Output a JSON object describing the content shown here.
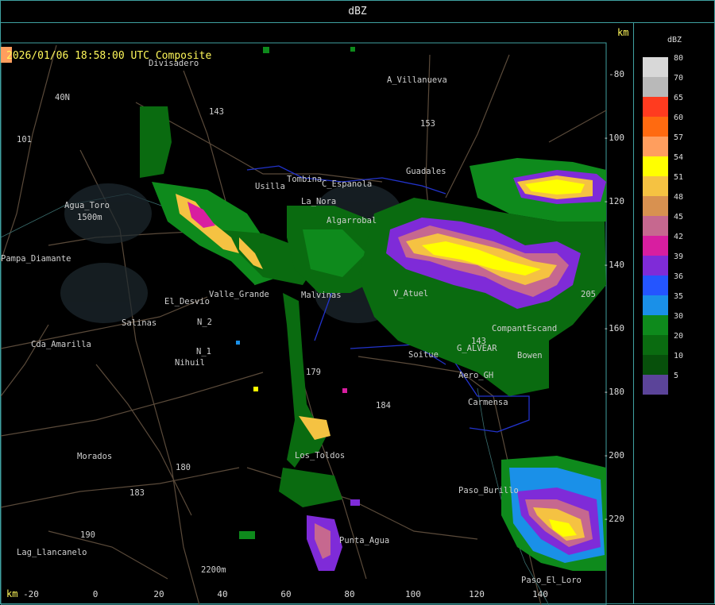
{
  "header": {
    "title": "dBZ"
  },
  "map": {
    "timestamp": "2026/01/06 18:58:00 UTC Composite",
    "km_top": "km",
    "km_bottom": "km",
    "x_axis_ticks": [
      "-20",
      "0",
      "20",
      "40",
      "60",
      "80",
      "100",
      "120",
      "140"
    ],
    "y_axis_ticks": [
      "-80",
      "-100",
      "-120",
      "-140",
      "-160",
      "-180",
      "-200",
      "-220"
    ],
    "places": [
      "Divisadero",
      "A_Villanueva",
      "Agua_Toro",
      "Pampa_Diamante",
      "El_Desvio",
      "Salinas",
      "Cda_Amarilla",
      "N_1",
      "Nihuil",
      "N_2",
      "Morados",
      "Lag_Llancanelo",
      "Los_Toldos",
      "Punta_Agua",
      "Guadales",
      "Soitue",
      "Carmensa",
      "Paso_Burillo",
      "Paso_El_Loro",
      "La_Nora",
      "Usilla",
      "Valle_Grande",
      "Malvinas",
      "V_Atuel",
      "Bowen",
      "Aero_GH",
      "G_ALVEAR",
      "CompantEscand",
      "C_Espanola",
      "Algarrobal",
      "Tombina"
    ],
    "route_labels": [
      "40N",
      "143",
      "101",
      "153",
      "179",
      "184",
      "180",
      "183",
      "190",
      "143",
      "205"
    ],
    "elevation_labels": [
      "1500m",
      "2200m"
    ]
  },
  "legend": {
    "unit": "dBZ",
    "entries": [
      {
        "value": "80",
        "color": "#d8d8d8"
      },
      {
        "value": "70",
        "color": "#b9b9b9"
      },
      {
        "value": "65",
        "color": "#ff3b1f"
      },
      {
        "value": "60",
        "color": "#ff6a10"
      },
      {
        "value": "57",
        "color": "#ff9e5e"
      },
      {
        "value": "54",
        "color": "#ffff00"
      },
      {
        "value": "51",
        "color": "#f5c242"
      },
      {
        "value": "48",
        "color": "#d89150"
      },
      {
        "value": "45",
        "color": "#c6688f"
      },
      {
        "value": "42",
        "color": "#d81ea0"
      },
      {
        "value": "39",
        "color": "#7f2bd8"
      },
      {
        "value": "36",
        "color": "#2455ff"
      },
      {
        "value": "35",
        "color": "#1a90e8"
      },
      {
        "value": "30",
        "color": "#0e8a1c"
      },
      {
        "value": "20",
        "color": "#0a6b10"
      },
      {
        "value": "10",
        "color": "#07500b"
      },
      {
        "value": "5",
        "color": "#5b4499"
      }
    ]
  }
}
